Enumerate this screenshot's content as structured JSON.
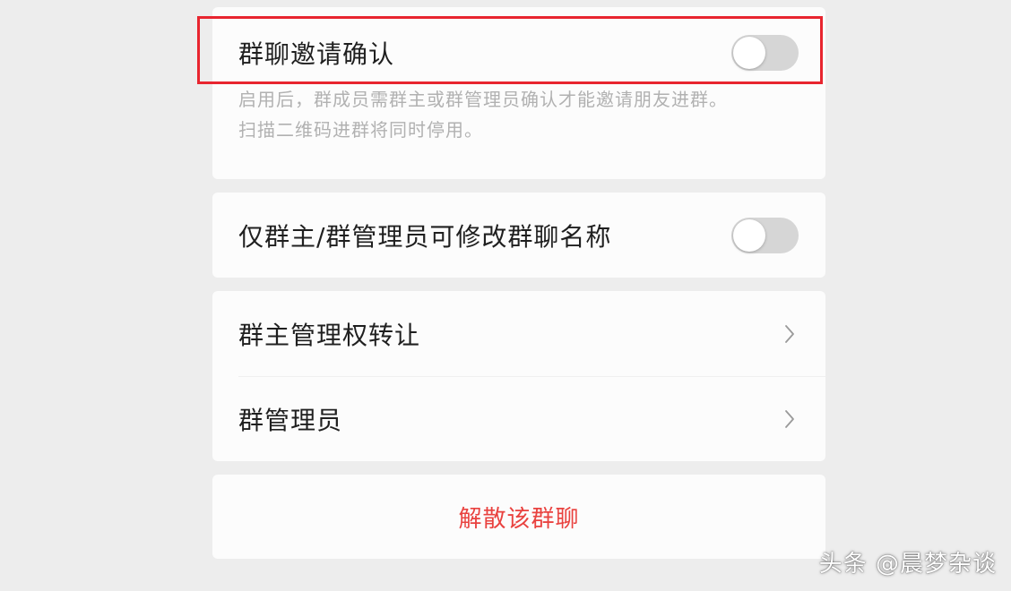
{
  "settings": {
    "invite_confirm": {
      "label": "群聊邀请确认",
      "enabled": false,
      "description_line1": "启用后，群成员需群主或群管理员确认才能邀请朋友进群。",
      "description_line2": "扫描二维码进群将同时停用。"
    },
    "rename_restrict": {
      "label": "仅群主/群管理员可修改群聊名称",
      "enabled": false
    },
    "transfer_owner": {
      "label": "群主管理权转让",
      "icon": "chevron-right-icon"
    },
    "admins": {
      "label": "群管理员",
      "icon": "chevron-right-icon"
    },
    "dissolve": {
      "label": "解散该群聊",
      "color": "#e9423f"
    }
  },
  "highlight": {
    "color": "#e8252f"
  },
  "watermark": {
    "text": "头条 @晨梦杂谈"
  },
  "colors": {
    "background": "#ededed",
    "card": "#fcfcfc",
    "toggle_off": "#d6d6d6",
    "danger": "#e9423f"
  }
}
